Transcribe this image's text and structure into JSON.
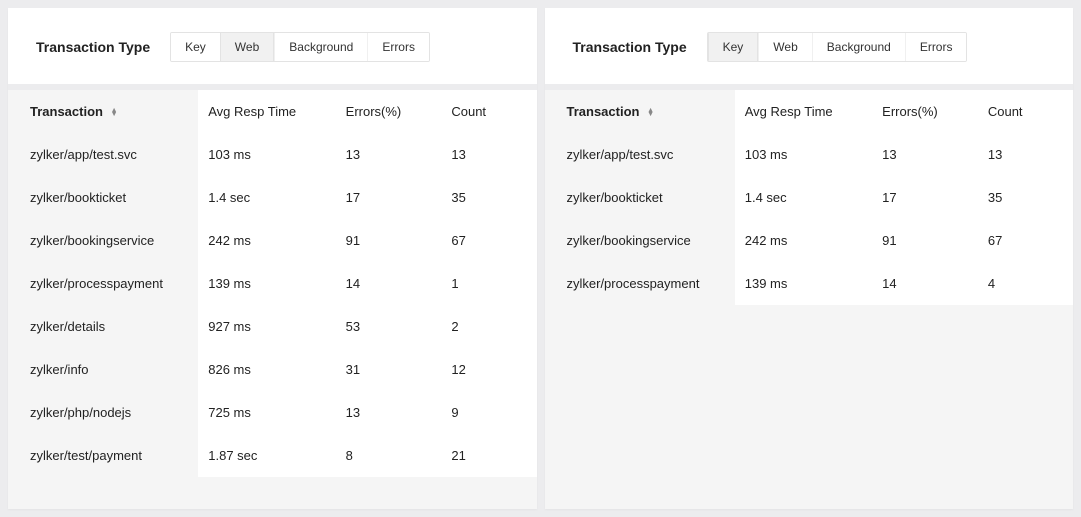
{
  "panels": [
    {
      "title": "Transaction Type",
      "tabs": [
        "Key",
        "Web",
        "Background",
        "Errors"
      ],
      "active_tab": 1,
      "columns": {
        "name": "Transaction",
        "resp": "Avg Resp Time",
        "err": "Errors(%)",
        "cnt": "Count"
      },
      "rows": [
        {
          "name": "zylker/app/test.svc",
          "resp": "103 ms",
          "err": "13",
          "cnt": "13"
        },
        {
          "name": "zylker/bookticket",
          "resp": "1.4 sec",
          "err": "17",
          "cnt": "35"
        },
        {
          "name": "zylker/bookingservice",
          "resp": "242 ms",
          "err": "91",
          "cnt": "67"
        },
        {
          "name": "zylker/processpayment",
          "resp": "139 ms",
          "err": "14",
          "cnt": "1"
        },
        {
          "name": "zylker/details",
          "resp": "927 ms",
          "err": "53",
          "cnt": "2"
        },
        {
          "name": "zylker/info",
          "resp": "826 ms",
          "err": "31",
          "cnt": "12"
        },
        {
          "name": "zylker/php/nodejs",
          "resp": "725 ms",
          "err": "13",
          "cnt": "9"
        },
        {
          "name": "zylker/test/payment",
          "resp": "1.87 sec",
          "err": "8",
          "cnt": "21"
        }
      ]
    },
    {
      "title": "Transaction Type",
      "tabs": [
        "Key",
        "Web",
        "Background",
        "Errors"
      ],
      "active_tab": 0,
      "columns": {
        "name": "Transaction",
        "resp": "Avg Resp Time",
        "err": "Errors(%)",
        "cnt": "Count"
      },
      "rows": [
        {
          "name": "zylker/app/test.svc",
          "resp": "103 ms",
          "err": "13",
          "cnt": "13"
        },
        {
          "name": "zylker/bookticket",
          "resp": "1.4 sec",
          "err": "17",
          "cnt": "35"
        },
        {
          "name": "zylker/bookingservice",
          "resp": "242 ms",
          "err": "91",
          "cnt": "67"
        },
        {
          "name": "zylker/processpayment",
          "resp": "139 ms",
          "err": "14",
          "cnt": "4"
        }
      ]
    }
  ]
}
